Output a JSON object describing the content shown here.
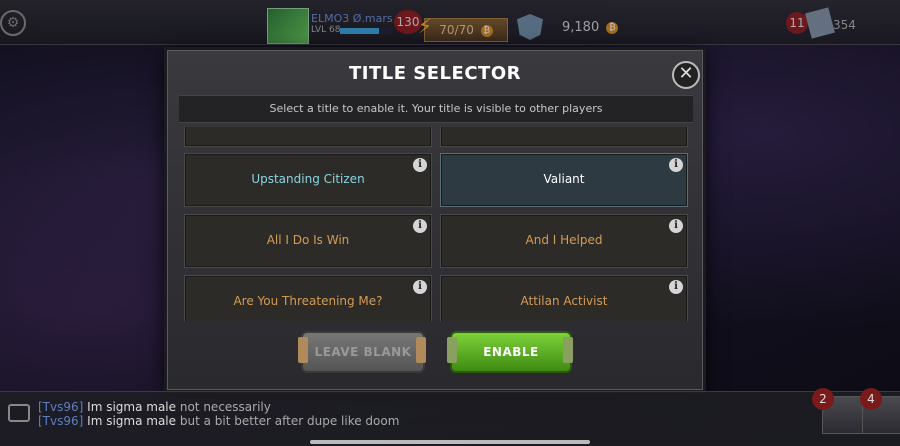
{
  "hud": {
    "player_name": "ELMO3 Ø.mars",
    "player_level": "LVL 68",
    "xp_fraction": 0.75,
    "alerts_count": "130",
    "energy": "70/70",
    "gold": "9,180",
    "coin_glyph": "₿",
    "notifications_count": "11",
    "units": "354"
  },
  "modal": {
    "title": "TITLE SELECTOR",
    "subtitle": "Select a title to enable it. Your title is visible to other players",
    "close_glyph": "✕",
    "titles": [
      {
        "label": ""
      },
      {
        "label": ""
      },
      {
        "label": "Upstanding Citizen"
      },
      {
        "label": "Valiant"
      },
      {
        "label": "All I Do Is Win"
      },
      {
        "label": "And I Helped"
      },
      {
        "label": "Are You Threatening Me?"
      },
      {
        "label": "Attilan Activist"
      }
    ],
    "info_glyph": "i",
    "leave_blank_label": "LEAVE BLANK",
    "enable_label": "ENABLE"
  },
  "chat": {
    "messages": [
      {
        "name": "[Tvs96]",
        "text": "Im sigma male",
        "reply": "not necessarily"
      },
      {
        "name": "[Tvs96]",
        "text": "Im sigma male",
        "reply": "but a bit better after dupe like doom"
      }
    ],
    "badge_left": "2",
    "badge_right": "4"
  },
  "colors": {
    "accent_green": "#5cb320",
    "title_orange": "#d59c56",
    "selected_bg": "#2e3a42"
  }
}
